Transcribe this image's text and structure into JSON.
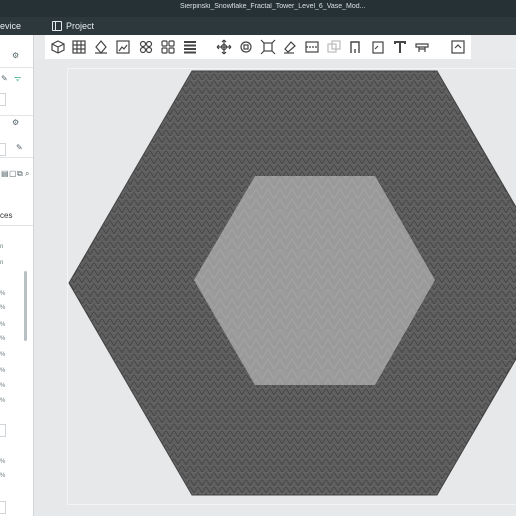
{
  "window": {
    "title": "Sierpinski_Snowflake_Fractal_Tower_Level_6_Vase_Mod..."
  },
  "menubar": {
    "device_tab": "evice",
    "project_tab": "Project"
  },
  "sidebar": {
    "labels": {
      "ces": "ces"
    },
    "field_values": [
      "n",
      "n",
      "%",
      "%",
      "%",
      "%",
      "%",
      "%",
      "%",
      "%"
    ],
    "extra_values": [
      "%",
      "%"
    ]
  },
  "toolbar": {
    "icons": [
      "add-cube-icon",
      "grid-icon",
      "orient-icon",
      "image-icon",
      "auto-arrange-icon",
      "arrange-icon",
      "list-icon",
      "move-icon",
      "rotate-icon",
      "scale-icon",
      "paint-icon",
      "cut-icon",
      "boolean-icon",
      "support-icon",
      "seam-icon",
      "text-icon",
      "measure-icon",
      "layers-icon"
    ]
  },
  "colors": {
    "accent": "#27a77a",
    "model": "#5d5d5d",
    "model_light": "#9a9a9a",
    "bed": "#e6e8ea"
  }
}
